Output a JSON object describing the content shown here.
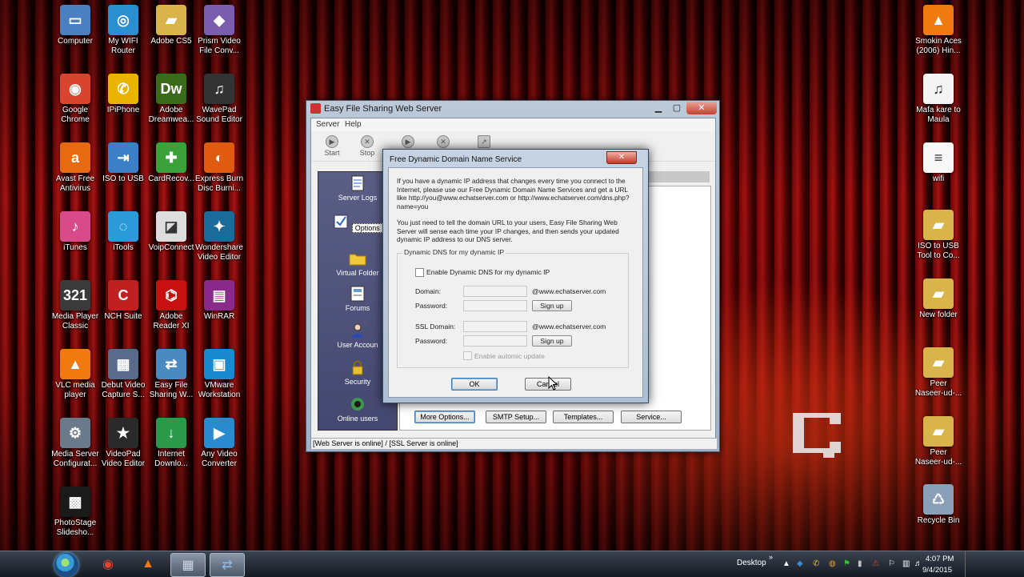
{
  "desktop": {
    "left_icons": [
      {
        "name": "computer-icon",
        "label": "Computer",
        "color": "#4a7fc0",
        "glyph": "▭"
      },
      {
        "name": "wifi-router-icon",
        "label": "My WIFI\nRouter",
        "color": "#2a8fd0",
        "glyph": "◎"
      },
      {
        "name": "folder-icon",
        "label": "Adobe CS5",
        "color": "#d9b44a",
        "glyph": "▰"
      },
      {
        "name": "prism-icon",
        "label": "Prism Video\nFile Conv...",
        "color": "#7b5db0",
        "glyph": "◆"
      },
      {
        "name": "chrome-icon",
        "label": "Google\nChrome",
        "color": "#d9442f",
        "glyph": "◉"
      },
      {
        "name": "phone-icon",
        "label": "IPiPhone",
        "color": "#e8b400",
        "glyph": "✆"
      },
      {
        "name": "dreamweaver-icon",
        "label": "Adobe\nDreamwea...",
        "color": "#3a6b1a",
        "glyph": "Dw"
      },
      {
        "name": "wavepad-icon",
        "label": "WavePad\nSound Editor",
        "color": "#333333",
        "glyph": "♫"
      },
      {
        "name": "avast-icon",
        "label": "Avast Free\nAntivirus",
        "color": "#e86a10",
        "glyph": "a"
      },
      {
        "name": "iso-usb-icon",
        "label": "ISO to USB",
        "color": "#3a7fc8",
        "glyph": "⇥"
      },
      {
        "name": "cardrecovery-icon",
        "label": "CardRecov...",
        "color": "#3aa03a",
        "glyph": "✚"
      },
      {
        "name": "burn-icon",
        "label": "Express Burn\nDisc Burni...",
        "color": "#e05a10",
        "glyph": "◐"
      },
      {
        "name": "itunes-icon",
        "label": "iTunes",
        "color": "#d84a8a",
        "glyph": "♪"
      },
      {
        "name": "itools-icon",
        "label": "iTools",
        "color": "#2a9ad8",
        "glyph": "◌"
      },
      {
        "name": "voipconnect-icon",
        "label": "VoipConnect",
        "color": "#dddddd",
        "glyph": "◪"
      },
      {
        "name": "wondershare-icon",
        "label": "Wondershare\nVideo Editor",
        "color": "#1a6a9a",
        "glyph": "✦"
      },
      {
        "name": "mediaplayer-icon",
        "label": "Media Player\nClassic",
        "color": "#3a3a3a",
        "glyph": "321"
      },
      {
        "name": "nch-icon",
        "label": "NCH Suite",
        "color": "#c02020",
        "glyph": "C"
      },
      {
        "name": "adobe-reader-icon",
        "label": "Adobe\nReader XI",
        "color": "#c81010",
        "glyph": "⌬"
      },
      {
        "name": "winrar-icon",
        "label": "WinRAR",
        "color": "#8a2a8a",
        "glyph": "▤"
      },
      {
        "name": "vlc-icon",
        "label": "VLC media\nplayer",
        "color": "#f07a10",
        "glyph": "▲"
      },
      {
        "name": "debut-icon",
        "label": "Debut Video\nCapture S...",
        "color": "#5a6a8a",
        "glyph": "▦"
      },
      {
        "name": "easy-file-sharing-icon",
        "label": "Easy File\nSharing W...",
        "color": "#4a8ac0",
        "glyph": "⇄"
      },
      {
        "name": "vmware-icon",
        "label": "VMware\nWorkstation",
        "color": "#1a8ad0",
        "glyph": "▣"
      },
      {
        "name": "media-server-icon",
        "label": "Media Server\nConfigurat...",
        "color": "#6a7a8a",
        "glyph": "⚙"
      },
      {
        "name": "videopad-icon",
        "label": "VideoPad\nVideo Editor",
        "color": "#2a2a2a",
        "glyph": "★"
      },
      {
        "name": "idm-icon",
        "label": "Internet\nDownlo...",
        "color": "#2a9a4a",
        "glyph": "↓"
      },
      {
        "name": "any-video-icon",
        "label": "Any Video\nConverter",
        "color": "#2a8ad0",
        "glyph": "▶"
      },
      {
        "name": "photostage-icon",
        "label": "PhotoStage\nSlidesho...",
        "color": "#1a1a1a",
        "glyph": "▩"
      }
    ],
    "right_icons": [
      {
        "name": "vlc-shortcut-icon",
        "label": "Smokin Aces\n(2006) Hin...",
        "color": "#f07a10",
        "glyph": "▲"
      },
      {
        "name": "mp3-file-icon",
        "label": "Mafa kare to\nMaula",
        "color": "#f4f4f4",
        "glyph": "♫"
      },
      {
        "name": "text-file-icon",
        "label": "wifi",
        "color": "#f8f8f8",
        "glyph": "≡"
      },
      {
        "name": "folder-iso-icon",
        "label": "ISO to USB\nTool to Co...",
        "color": "#d9b44a",
        "glyph": "▰"
      },
      {
        "name": "new-folder-icon",
        "label": "New folder",
        "color": "#d9b44a",
        "glyph": "▰"
      },
      {
        "name": "folder-peer-icon",
        "label": "Peer\nNaseer-ud-...",
        "color": "#d9b44a",
        "glyph": "▰"
      },
      {
        "name": "folder-peer-2-icon",
        "label": "Peer\nNaseer-ud-...",
        "color": "#d9b44a",
        "glyph": "▰"
      },
      {
        "name": "recycle-bin-icon",
        "label": "Recycle Bin",
        "color": "#8aa0b8",
        "glyph": "♺"
      }
    ]
  },
  "efs_window": {
    "title": "Easy File Sharing Web Server",
    "menu": {
      "server": "Server",
      "help": "Help"
    },
    "toolbar": {
      "start": "Start",
      "stop": "Stop"
    },
    "sidebar": {
      "server_logs": "Server Logs",
      "options": "Options",
      "virtual_folder": "Virtual Folder",
      "forums": "Forums",
      "user_accounts": "User Accoun",
      "security": "Security",
      "online_users": "Online users"
    },
    "buttons": {
      "more_options": "More Options...",
      "smtp_setup": "SMTP Setup...",
      "templates": "Templates...",
      "service": "Service..."
    },
    "status": "[Web Server is online] / [SSL Server is online]"
  },
  "dialog": {
    "title": "Free Dynamic Domain Name Service",
    "intro_1": "If you have a dynamic IP address that changes every time you connect to the Internet, please use our Free Dynamic Domain Name Services and get a URL like http://you@www.echatserver.com or http://www.echatserver.com/dns.php?name=you",
    "intro_2": "You just need to tell the domain URL to your users, Easy File Sharing Web Server will sense each time your IP changes, and then sends your updated dynamic IP address to our DNS server.",
    "group_label": "Dynamic DNS for my dynamic IP",
    "enable_label": "Enable Dynamic DNS for my dynamic IP",
    "domain_label": "Domain:",
    "password_label": "Password:",
    "domain_suffix": "@www.echatserver.com",
    "signup_label": "Sign up",
    "ssl_domain_label": "SSL Domain:",
    "ssl_password_label": "Password:",
    "ssl_domain_suffix": "@www.echatserver.com",
    "ssl_signup_label": "Sign up",
    "auto_update_label": "Enable automic update",
    "ok_label": "OK",
    "cancel_label": "Cancel"
  },
  "taskbar": {
    "desktop_label": "Desktop",
    "chevron": "»",
    "time": "4:07 PM",
    "date": "9/4/2015"
  }
}
